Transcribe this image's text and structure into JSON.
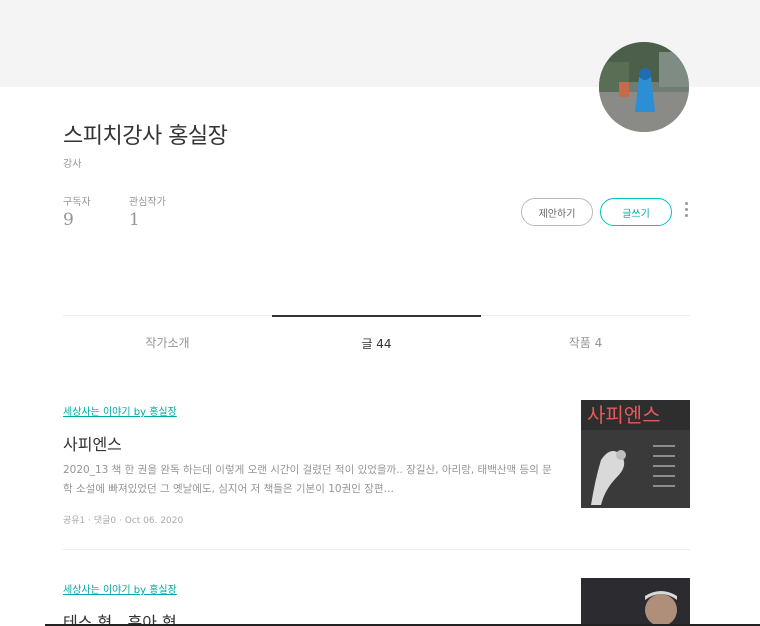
{
  "profile": {
    "name": "스피치강사 홍실장",
    "job": "강사",
    "stats": {
      "subscribers_label": "구독자",
      "subscribers_value": "9",
      "following_label": "관심작가",
      "following_value": "1"
    },
    "buttons": {
      "propose": "제안하기",
      "write": "글쓰기"
    }
  },
  "tabs": [
    {
      "label": "작가소개"
    },
    {
      "label": "글 44"
    },
    {
      "label": "작품 4"
    }
  ],
  "articles": [
    {
      "magazine": "세상사는 이야기 by 홍실장",
      "title": "사피엔스",
      "excerpt": "2020_13   책 한 권을 완독 하는데 이렇게 오랜 시간이 걸렸던 적이 있었을까.. 장길산, 아리랑, 태백산맥 등의 문학 소설에 빠져있었던 그 옛날에도, 심지어 저 책들은 기본이 10권인 장편…",
      "meta": "공유1 · 댓글0 · Oct 06. 2020",
      "thumb_text": "사피엔스"
    },
    {
      "magazine": "세상사는 이야기 by 홍실장",
      "title": "테스 형.. 훈아 형.."
    }
  ],
  "colors": {
    "accent": "#00a9a2",
    "cover": "#f4f4f4"
  }
}
